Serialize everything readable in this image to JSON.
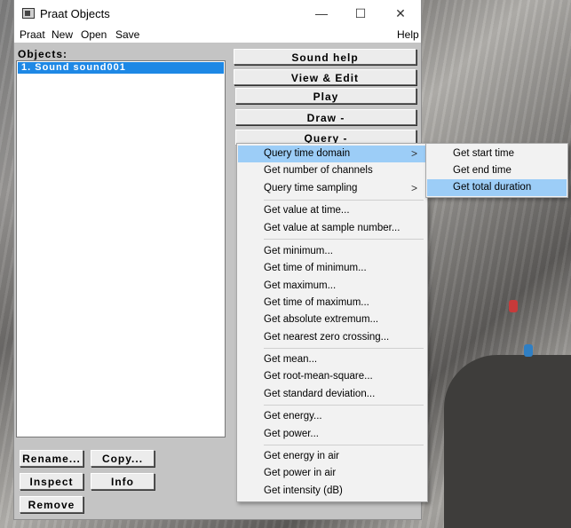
{
  "window": {
    "title": "Praat Objects",
    "minimize_glyph": "—",
    "maximize_glyph": "☐",
    "close_glyph": "✕"
  },
  "menubar": {
    "items": [
      "Praat",
      "New",
      "Open",
      "Save"
    ],
    "help": "Help"
  },
  "objects": {
    "label": "Objects:",
    "items": [
      "1. Sound sound001"
    ]
  },
  "action_buttons": [
    "Sound help",
    "View & Edit",
    "Play",
    "Draw -",
    "Query -"
  ],
  "query_menu": {
    "items": [
      {
        "label": "Query time domain",
        "has_submenu": true,
        "highlighted": true
      },
      {
        "label": "Get number of channels"
      },
      {
        "label": "Query time sampling",
        "has_submenu": true
      },
      {
        "label": "Get value at time..."
      },
      {
        "label": "Get value at sample number..."
      },
      {
        "label": "Get minimum..."
      },
      {
        "label": "Get time of minimum..."
      },
      {
        "label": "Get maximum..."
      },
      {
        "label": "Get time of maximum..."
      },
      {
        "label": "Get absolute extremum..."
      },
      {
        "label": "Get nearest zero crossing..."
      },
      {
        "label": "Get mean..."
      },
      {
        "label": "Get root-mean-square..."
      },
      {
        "label": "Get standard deviation..."
      },
      {
        "label": "Get energy..."
      },
      {
        "label": "Get power..."
      },
      {
        "label": "Get energy in air"
      },
      {
        "label": "Get power in air"
      },
      {
        "label": "Get intensity (dB)"
      }
    ],
    "submenu_arrow": ">"
  },
  "time_domain_submenu": {
    "items": [
      "Get start time",
      "Get end time",
      "Get total duration"
    ],
    "highlighted_index": 2
  },
  "bottom_buttons": {
    "rename": "Rename...",
    "copy": "Copy...",
    "inspect": "Inspect",
    "info": "Info",
    "remove": "Remove"
  },
  "colors": {
    "selection": "#1e88e5",
    "menu_highlight": "#9ccdf7",
    "window_bg": "#c4c4c4"
  }
}
